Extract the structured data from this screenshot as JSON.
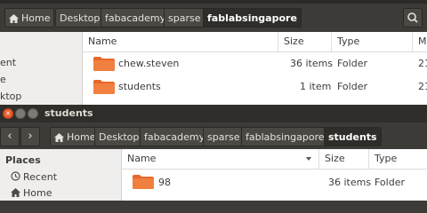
{
  "back_window": {
    "title_partial": "fablabsingapore",
    "breadcrumbs": [
      "Home",
      "Desktop",
      "fabacademy",
      "sparse",
      "fablabsingapore"
    ],
    "sidebar": [
      "ent",
      "e",
      "ktop"
    ],
    "columns": [
      "Name",
      "Size",
      "Type",
      "M"
    ],
    "rows": [
      {
        "name": "chew.steven",
        "size": "36 items",
        "type": "Folder",
        "modified": "21"
      },
      {
        "name": "students",
        "size": "1 item",
        "type": "Folder",
        "modified": "21"
      }
    ]
  },
  "front_window": {
    "title": "students",
    "close_glyph": "×",
    "nav": {
      "back": "‹",
      "forward": "›"
    },
    "breadcrumbs": [
      "Home",
      "Desktop",
      "fabacademy",
      "sparse",
      "fablabsingapore",
      "students"
    ],
    "sidebar": {
      "heading": "Places",
      "items": [
        {
          "label": "Recent",
          "icon": "clock-icon"
        },
        {
          "label": "Home",
          "icon": "home-icon"
        }
      ]
    },
    "columns": [
      "Name",
      "Size",
      "Type"
    ],
    "rows": [
      {
        "name": "98",
        "size": "36 items",
        "type": "Folder"
      }
    ]
  },
  "colors": {
    "folder": "#e8672a",
    "toolbar": "#3c3b37",
    "close": "#e85a2b"
  }
}
